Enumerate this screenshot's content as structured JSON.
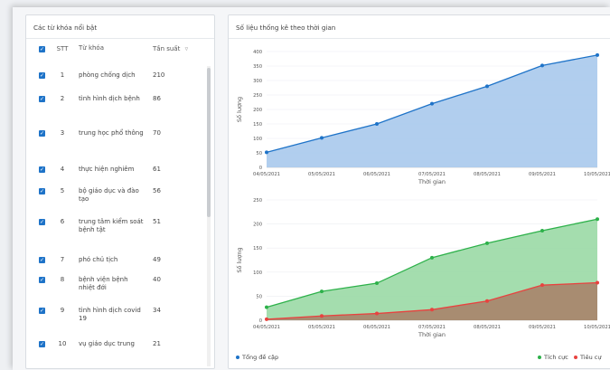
{
  "keywords_panel": {
    "title": "Các từ khóa nổi bật",
    "columns": {
      "stt": "STT",
      "keyword": "Từ khóa",
      "frequency": "Tần suất"
    },
    "rows": [
      {
        "stt": "1",
        "keyword": "phòng chống dịch",
        "freq": "210"
      },
      {
        "stt": "2",
        "keyword": "tình hình dịch bệnh",
        "freq": "86"
      },
      {
        "stt": "3",
        "keyword": "trung học phổ thông",
        "freq": "70"
      },
      {
        "stt": "4",
        "keyword": "thực hiện nghiêm",
        "freq": "61"
      },
      {
        "stt": "5",
        "keyword": "bộ giáo dục và đào tạo",
        "freq": "56"
      },
      {
        "stt": "6",
        "keyword": "trung tâm kiểm soát bệnh tật",
        "freq": "51"
      },
      {
        "stt": "7",
        "keyword": "phó chủ tịch",
        "freq": "49"
      },
      {
        "stt": "8",
        "keyword": "bệnh viện bệnh nhiệt đới",
        "freq": "40"
      },
      {
        "stt": "9",
        "keyword": "tình hình dịch covid 19",
        "freq": "34"
      },
      {
        "stt": "10",
        "keyword": "vụ giáo dục trung",
        "freq": "21"
      }
    ]
  },
  "stats_panel": {
    "title": "Số liệu thống kê theo thời gian"
  },
  "chart_data": [
    {
      "type": "area",
      "x": [
        "04/05/2021",
        "05/05/2021",
        "06/05/2021",
        "07/05/2021",
        "08/05/2021",
        "09/05/2021",
        "10/05/2021"
      ],
      "series": [
        {
          "name": "Tổng đề cập",
          "color": "#1e73c8",
          "fill": "#a9c9ec",
          "values": [
            52,
            102,
            150,
            220,
            280,
            352,
            388
          ]
        }
      ],
      "xlabel": "Thời gian",
      "ylabel": "Số lượng",
      "ylim": [
        0,
        400
      ],
      "yticks": [
        0,
        50,
        100,
        150,
        200,
        250,
        300,
        350,
        400
      ],
      "grid": true,
      "legend_position": "bottom-left"
    },
    {
      "type": "area",
      "x": [
        "04/05/2021",
        "05/05/2021",
        "06/05/2021",
        "07/05/2021",
        "08/05/2021",
        "09/05/2021",
        "10/05/2021"
      ],
      "series": [
        {
          "name": "Tích cực",
          "color": "#2db14a",
          "fill": "#9ad9a5",
          "values": [
            27,
            60,
            77,
            130,
            160,
            186,
            210
          ]
        },
        {
          "name": "Tiêu cự",
          "color": "#e8423f",
          "fill": "#a8836a",
          "values": [
            2,
            9,
            14,
            22,
            40,
            73,
            78
          ]
        }
      ],
      "xlabel": "Thời gian",
      "ylabel": "Số lượng",
      "ylim": [
        0,
        250
      ],
      "yticks": [
        0,
        50,
        100,
        150,
        200,
        250
      ],
      "grid": true,
      "legend_position": "bottom-right"
    }
  ]
}
